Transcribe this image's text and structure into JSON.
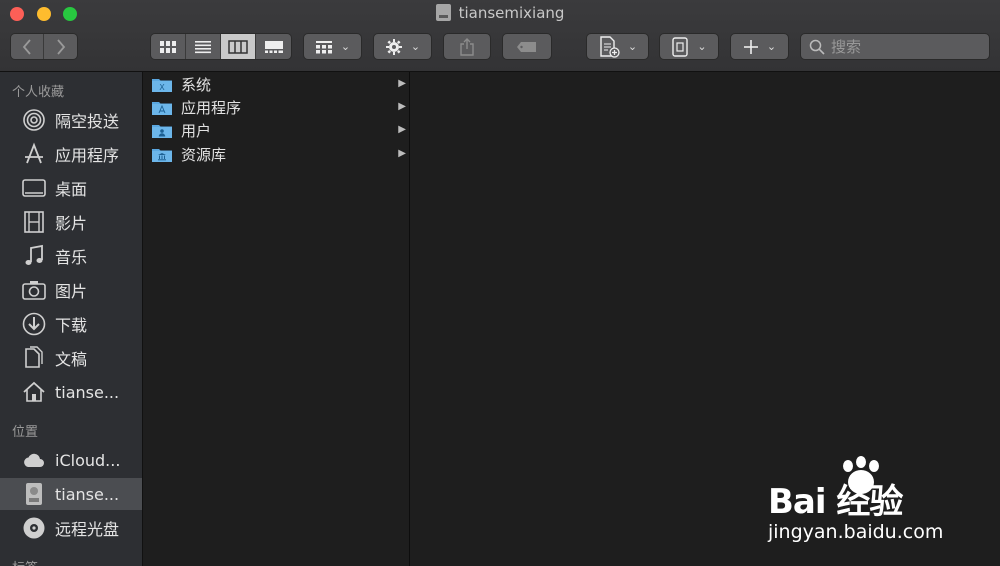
{
  "window": {
    "title": "tiansemixiang"
  },
  "toolbar": {
    "search_placeholder": "搜索",
    "buttons": [
      "back-icon",
      "forward-icon",
      "icon-view",
      "list-view",
      "column-view",
      "gallery-view",
      "group-by",
      "action-gear",
      "share",
      "tags",
      "new-document",
      "drive",
      "add"
    ]
  },
  "sidebar": {
    "favorites_heading": "个人收藏",
    "favorites": [
      {
        "label": "隔空投送",
        "icon": "airdrop-icon"
      },
      {
        "label": "应用程序",
        "icon": "applications-icon"
      },
      {
        "label": "桌面",
        "icon": "desktop-icon"
      },
      {
        "label": "影片",
        "icon": "movies-icon"
      },
      {
        "label": "音乐",
        "icon": "music-icon"
      },
      {
        "label": "图片",
        "icon": "pictures-icon"
      },
      {
        "label": "下载",
        "icon": "downloads-icon"
      },
      {
        "label": "文稿",
        "icon": "documents-icon"
      },
      {
        "label": "tianse...",
        "icon": "home-icon"
      }
    ],
    "locations_heading": "位置",
    "locations": [
      {
        "label": "iCloud...",
        "icon": "icloud-icon"
      },
      {
        "label": "tianse...",
        "icon": "disk-icon",
        "selected": true
      },
      {
        "label": "远程光盘",
        "icon": "remote-disc-icon"
      }
    ],
    "tags_heading": "标签"
  },
  "column1": {
    "items": [
      {
        "label": "系统",
        "icon": "system-folder-icon"
      },
      {
        "label": "应用程序",
        "icon": "applications-folder-icon"
      },
      {
        "label": "用户",
        "icon": "users-folder-icon"
      },
      {
        "label": "资源库",
        "icon": "library-folder-icon"
      }
    ]
  },
  "watermark": {
    "logo": "Bai 经验",
    "url": "jingyan.baidu.com"
  },
  "colors": {
    "folder": "#5aa7e0",
    "sidebar_bg": "#2d2f33",
    "content_bg": "#1e1e1e"
  }
}
